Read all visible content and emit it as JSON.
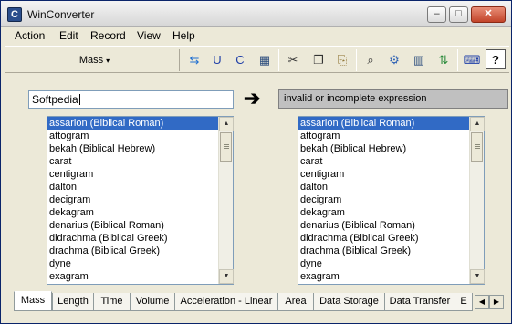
{
  "window": {
    "title": "WinConverter",
    "icon_letter": "C"
  },
  "titlebar_buttons": {
    "minimize": "–",
    "maximize": "□",
    "close": "✕"
  },
  "menu": [
    "Action",
    "Edit",
    "Record",
    "View",
    "Help"
  ],
  "toolbar": {
    "category_label": "Mass",
    "category_caret": "▾",
    "tools": [
      {
        "name": "swap-icon",
        "glyph": "⇆",
        "color": "#1f6fd1"
      },
      {
        "name": "edit-units-icon",
        "glyph": "U",
        "color": "#1f3fa8"
      },
      {
        "name": "edit-convert-icon",
        "glyph": "C",
        "color": "#1f3fa8"
      },
      {
        "name": "table-icon",
        "glyph": "▦",
        "color": "#2a4b7c"
      },
      {
        "name": "cut-icon",
        "glyph": "✂",
        "color": "#333333"
      },
      {
        "name": "copy-icon",
        "glyph": "❐",
        "color": "#333333"
      },
      {
        "name": "paste-icon",
        "glyph": "⎘",
        "color": "#8a6d2a"
      },
      {
        "name": "find-icon",
        "glyph": "⌕",
        "color": "#2a2a2a"
      },
      {
        "name": "settings-icon",
        "glyph": "⚙",
        "color": "#2b5fb3"
      },
      {
        "name": "columns-icon",
        "glyph": "▥",
        "color": "#2a4b7c"
      },
      {
        "name": "sort-az-icon",
        "glyph": "⇅",
        "color": "#2a8a3a"
      },
      {
        "name": "keyboard-icon",
        "glyph": "⌨",
        "color": "#1f3fa8"
      },
      {
        "name": "help-icon",
        "glyph": "?",
        "color": "#000000"
      }
    ]
  },
  "converter": {
    "input_value": "Softpedia",
    "arrow": "➔",
    "result": "invalid or incomplete expression"
  },
  "units": [
    "assarion (Biblical Roman)",
    "attogram",
    "bekah (Biblical Hebrew)",
    "carat",
    "centigram",
    "dalton",
    "decigram",
    "dekagram",
    "denarius (Biblical Roman)",
    "didrachma (Biblical Greek)",
    "drachma (Biblical Greek)",
    "dyne",
    "exagram"
  ],
  "from_selected": "assarion (Biblical Roman)",
  "to_selected": "assarion (Biblical Roman)",
  "tabs": [
    "Mass",
    "Length",
    "Time",
    "Volume",
    "Acceleration - Linear",
    "Area",
    "Data Storage",
    "Data Transfer",
    "E"
  ],
  "active_tab": "Mass",
  "tab_scroll": {
    "left": "◀",
    "right": "▶"
  },
  "scrollbar": {
    "up": "▲",
    "down": "▼"
  },
  "colors": {
    "selection": "#316ac5",
    "result_bg": "#c0c0c0",
    "window_bg": "#ece9d8"
  }
}
